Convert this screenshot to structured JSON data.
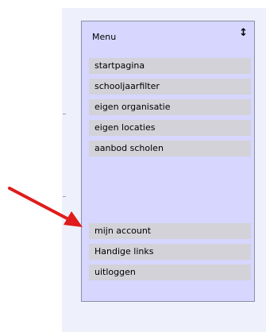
{
  "menu": {
    "title": "Menu",
    "sort_icon": "sort-icon",
    "items": [
      {
        "label": "startpagina"
      },
      {
        "label": "schooljaarfilter"
      },
      {
        "label": "eigen organisatie"
      },
      {
        "label": "eigen locaties"
      },
      {
        "label": "aanbod scholen"
      },
      {
        "label": "mijn account"
      },
      {
        "label": "Handige links"
      },
      {
        "label": "uitloggen"
      }
    ]
  },
  "colors": {
    "menu_background": "#d6d6ff",
    "item_background": "#d2d2d8",
    "panel_background": "#eef0fb",
    "annotation_arrow": "#e01b1b"
  }
}
